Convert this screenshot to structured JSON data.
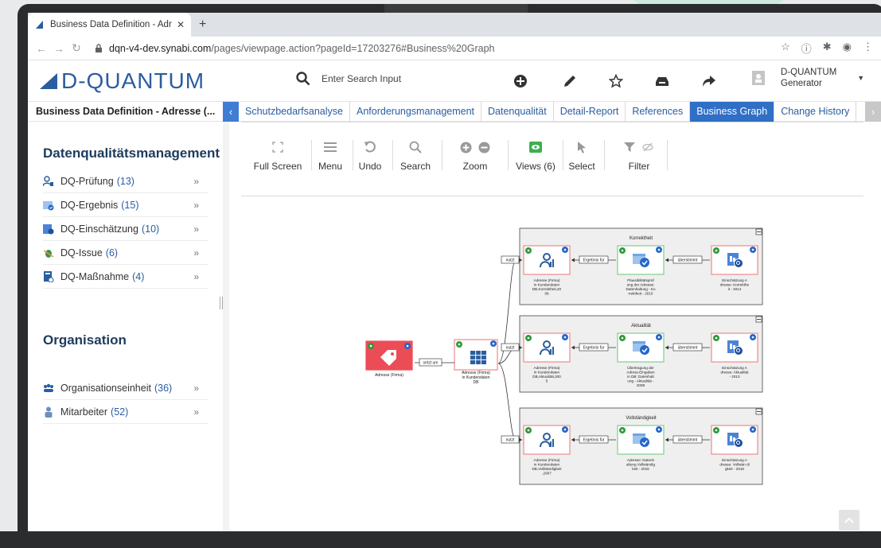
{
  "browser": {
    "tab_title": "Business Data Definition - Adre",
    "url_host": "dqn-v4-dev.synabi.com",
    "url_path": "/pages/viewpage.action?pageId=17203276#Business%20Graph"
  },
  "header": {
    "logo_text": "D-QUANTUM",
    "search_placeholder": "Enter Search Input",
    "user_line1": "D-QUANTUM",
    "user_line2": "Generator"
  },
  "nav": {
    "page_title": "Business Data Definition - Adresse (...",
    "tabs": [
      {
        "label": "Schutzbedarfsanalyse"
      },
      {
        "label": "Anforderungsmanagement"
      },
      {
        "label": "Datenqualität"
      },
      {
        "label": "Detail-Report"
      },
      {
        "label": "References"
      },
      {
        "label": "Business Graph"
      },
      {
        "label": "Change History"
      }
    ],
    "active_tab": "Business Graph"
  },
  "sidebar": {
    "section1_title": "Datenqualitätsmanagement",
    "section1_items": [
      {
        "label": "DQ-Prüfung",
        "count": "(13)",
        "icon": "dq-check-icon"
      },
      {
        "label": "DQ-Ergebnis",
        "count": "(15)",
        "icon": "dq-result-icon"
      },
      {
        "label": "DQ-Einschätzung",
        "count": "(10)",
        "icon": "dq-assessment-icon"
      },
      {
        "label": "DQ-Issue",
        "count": "(6)",
        "icon": "dq-issue-icon"
      },
      {
        "label": "DQ-Maßnahme",
        "count": "(4)",
        "icon": "dq-measure-icon"
      }
    ],
    "section2_title": "Organisation",
    "section2_items": [
      {
        "label": "Organisationseinheit",
        "count": "(36)",
        "icon": "org-unit-icon"
      },
      {
        "label": "Mitarbeiter",
        "count": "(52)",
        "icon": "employee-icon"
      }
    ],
    "chevron": "»"
  },
  "toolbar": {
    "full_screen": "Full Screen",
    "menu": "Menu",
    "undo": "Undo",
    "search": "Search",
    "zoom": "Zoom",
    "views": "Views (6)",
    "select": "Select",
    "filter": "Filter"
  },
  "graph": {
    "root_node": "Adresse (Firma)",
    "root_edge": "setzt um",
    "db_node": [
      "Adresse (Firma)",
      "in Kundendaten",
      "DB"
    ],
    "edge_nutzt": "nutzt",
    "edge_ergebnis": "Ergebnis für",
    "edge_uebereinstimmt": "überstimmt",
    "groups": [
      {
        "title": "Korrektheit",
        "left": [
          "Adresse (Firma)",
          "in Kundendaten",
          "DB,Korrektheit,20",
          "06"
        ],
        "mid": [
          "Plausibilitätsprüf",
          "ung der Adresse:",
          "Datenhaltung - Ko",
          "rrektheit - 2010"
        ],
        "right": [
          "Einschätzung A",
          "dresse: Korrekthe",
          "it - 2014"
        ]
      },
      {
        "title": "Aktualität",
        "left": [
          "Adresse (Firma)",
          "in Kundendaten",
          "DB,Aktualität,200",
          "5"
        ],
        "mid": [
          "Übertragung der",
          "Adress-Eingaben",
          "in DB: Datenhalt",
          "ung - Aktualität -",
          "2008"
        ],
        "right": [
          "Einschätzung A",
          "dresse: Aktualität",
          "- 2013"
        ]
      },
      {
        "title": "Vollständigkeit",
        "left": [
          "Adresse (Firma)",
          "in Kundendaten",
          "DB,Vollständigkeit",
          ",2007"
        ],
        "mid": [
          "Adresse: Datenh",
          "altung Vollständig",
          "keit - 2015"
        ],
        "right": [
          "Einschätzung A",
          "dresse: Vollstän di",
          "gkeit - 2016"
        ]
      }
    ]
  },
  "colors": {
    "brand_blue": "#2a5d9f",
    "active_tab": "#2f6fc6",
    "root_node_red": "#ec4c55",
    "node_green_border": "#7fcf8a",
    "node_red_border": "#f08a8a",
    "badge_blue": "#2667c9",
    "badge_green": "#2f9a3b"
  }
}
